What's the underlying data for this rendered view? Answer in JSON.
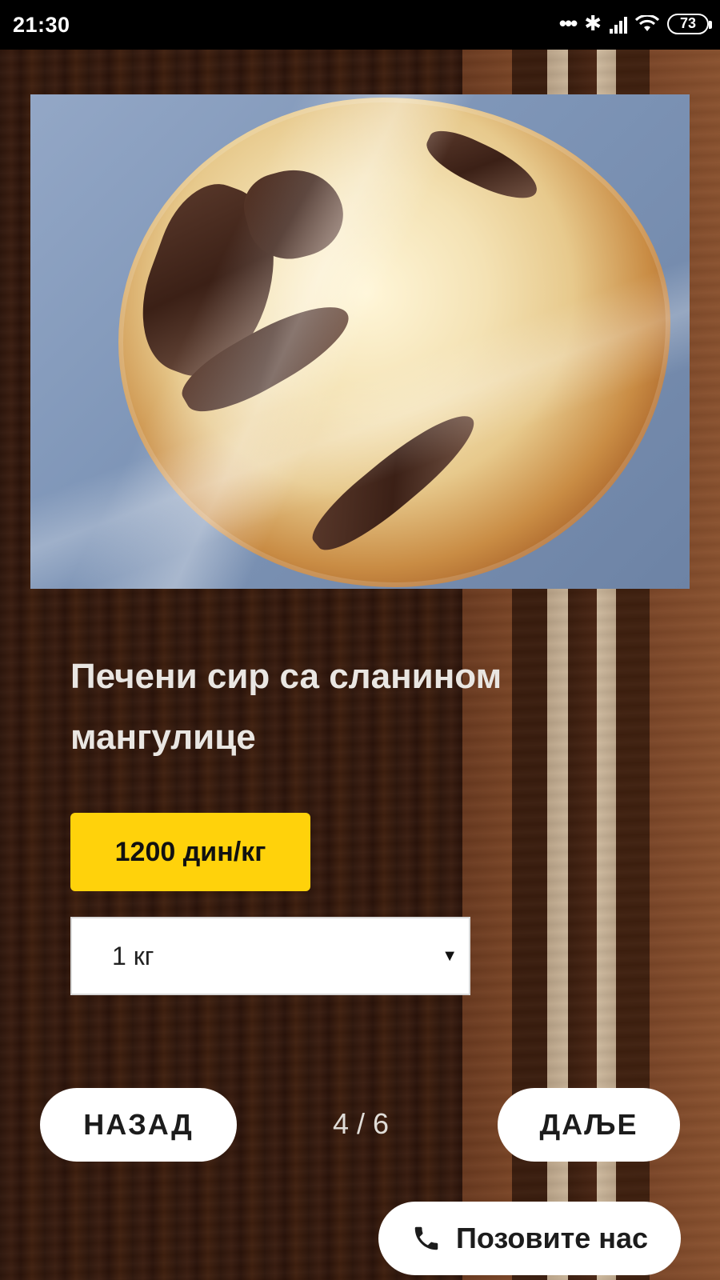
{
  "status_bar": {
    "time": "21:30",
    "battery": "73",
    "icons": [
      "dots-icon",
      "bluetooth-icon",
      "signal-icon",
      "wifi-icon",
      "battery-icon"
    ]
  },
  "product": {
    "title": "Печени сир са сланином мангулице",
    "price": "1200 дин/кг",
    "quantity_selected": "1 кг"
  },
  "navigation": {
    "back_label": "НАЗАД",
    "next_label": "ДАЉЕ",
    "page_counter": "4 / 6"
  },
  "call": {
    "label": "Позовите нас",
    "icon": "phone-icon"
  },
  "colors": {
    "price_badge": "#ffd20b",
    "button_bg": "#ffffff",
    "background": "#2a140c"
  }
}
